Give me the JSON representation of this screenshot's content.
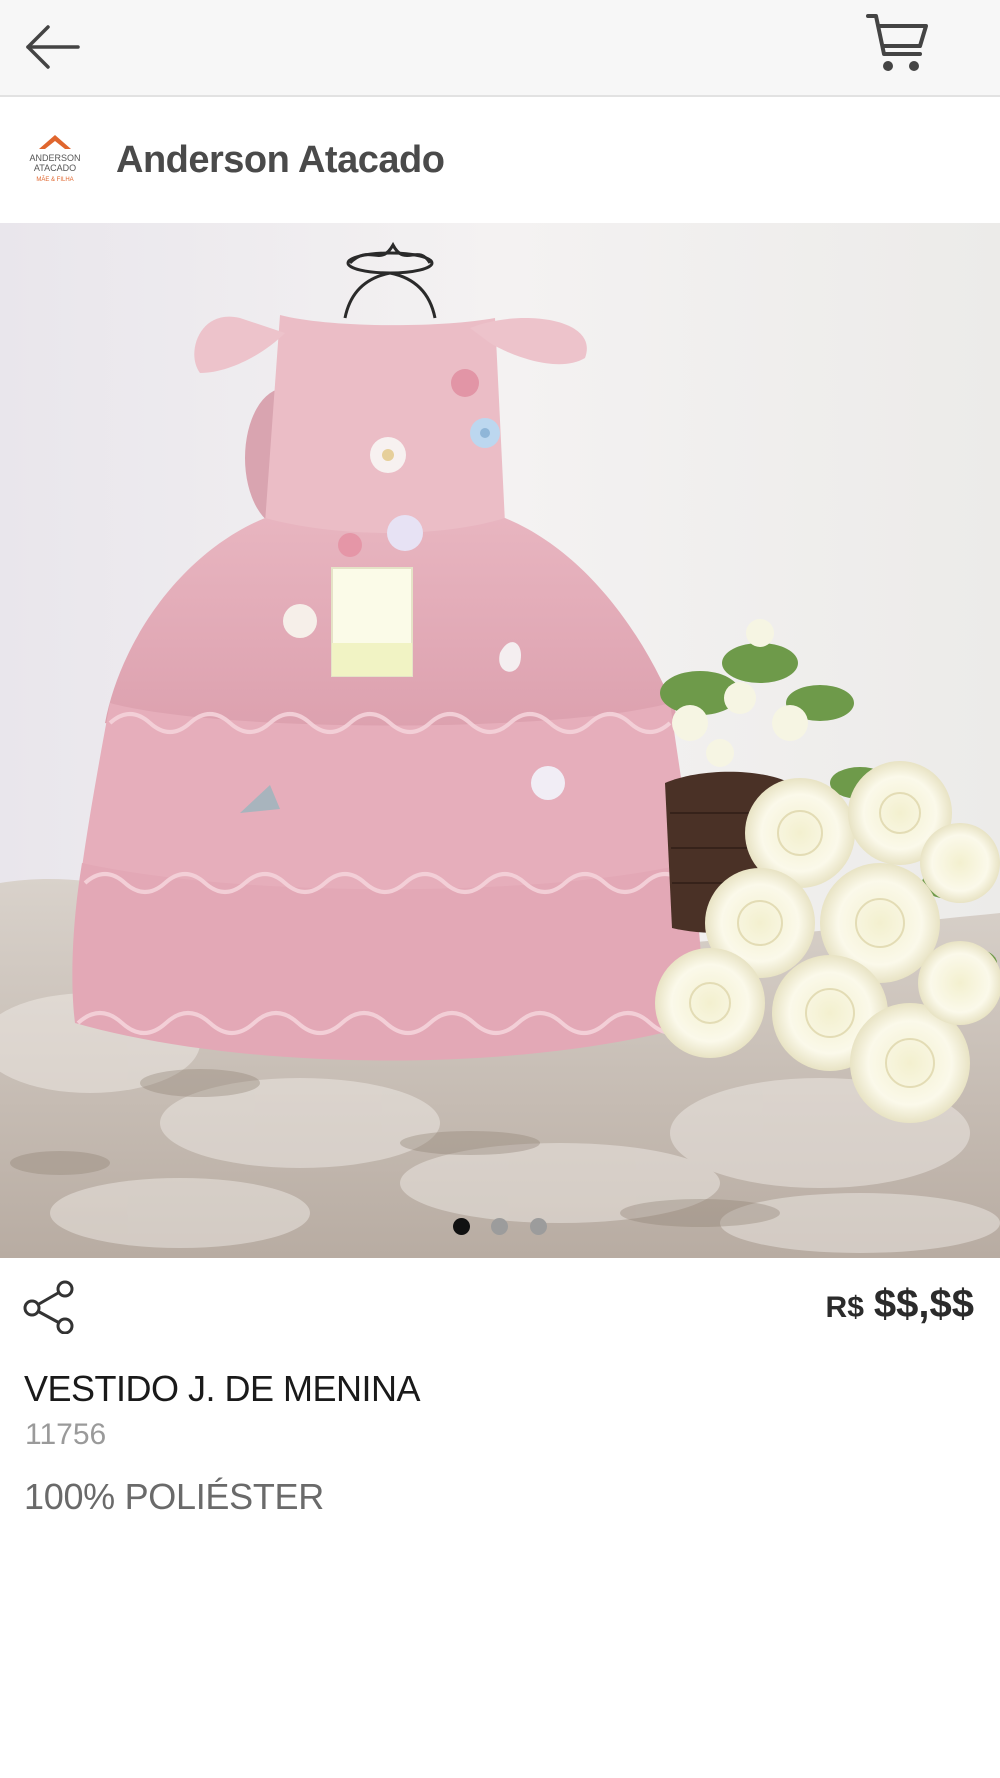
{
  "header": {
    "back_icon": "arrow-left-icon",
    "cart_icon": "shopping-cart-icon"
  },
  "store": {
    "name": "Anderson Atacado",
    "logo_lines": [
      "ANDERSON",
      "ATACADO",
      "MÃE & FILHA"
    ]
  },
  "gallery": {
    "image_subject": "pink tiered girls dress on crown mannequin with white roses",
    "total_images": 3,
    "active_index": 0,
    "colors": {
      "dot_active": "#111111",
      "dot_inactive": "#9c9c9c"
    }
  },
  "product": {
    "currency": "R$",
    "price": "$$,$$",
    "title": "VESTIDO J. DE MENINA",
    "code": "11756",
    "description": "100% POLIÉSTER"
  },
  "actions": {
    "share_icon": "share-icon"
  },
  "colors": {
    "topbar_bg": "#f7f7f7",
    "text_primary": "#1a1a1a",
    "text_muted": "#9a9a9a",
    "logo_accent": "#e0662e"
  }
}
